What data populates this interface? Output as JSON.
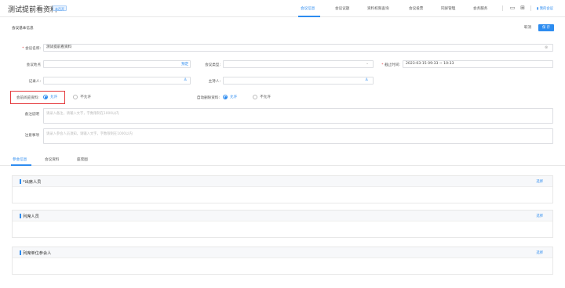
{
  "header": {
    "title": "测试提前看资料",
    "badge": "未召开",
    "tabs": [
      {
        "label": "会议信息",
        "active": true
      },
      {
        "label": "会议议题",
        "active": false
      },
      {
        "label": "资料权限查询",
        "active": false
      },
      {
        "label": "会议投票",
        "active": false
      },
      {
        "label": "同屏管理",
        "active": false
      },
      {
        "label": "会务服务",
        "active": false
      }
    ],
    "user": "我的会议",
    "accent_color": "#2d8cf0"
  },
  "form": {
    "section_title": "会议基本信息",
    "cancel_label": "取消",
    "save_label": "保 存",
    "name_label": "会议名称:",
    "name_value": "测试提前看资料",
    "location_label": "会议地点",
    "location_pick": "预定",
    "type_label": "会议类型:",
    "deadline_label": "截止时间:",
    "deadline_value": "2023-03-15 09:33 ~ 10:33",
    "recorder_label": "记录人:",
    "host_label": "主持人:",
    "preview_label": "会前阅览资料:",
    "preview_options": [
      "允许",
      "不允许"
    ],
    "autodelete_label": "自动删除资料:",
    "autodelete_options": [
      "允许",
      "不允许"
    ],
    "remark_label": "备注说明",
    "remark_placeholder": "请录入备注，请输入文字，字数限制在1000以内",
    "notice_label": "注意事项",
    "notice_placeholder": "请录入参会人员须知，请输入文字，字数限制在1000以内"
  },
  "sub_tabs": [
    {
      "label": "参会信息",
      "active": true
    },
    {
      "label": "会议资料",
      "active": false
    },
    {
      "label": "座席图",
      "active": false
    }
  ],
  "panels": [
    {
      "title": "*出席人员",
      "action": "选择"
    },
    {
      "title": "列席人员",
      "action": "选择"
    },
    {
      "title": "列席单位参会人",
      "action": "选择"
    }
  ]
}
